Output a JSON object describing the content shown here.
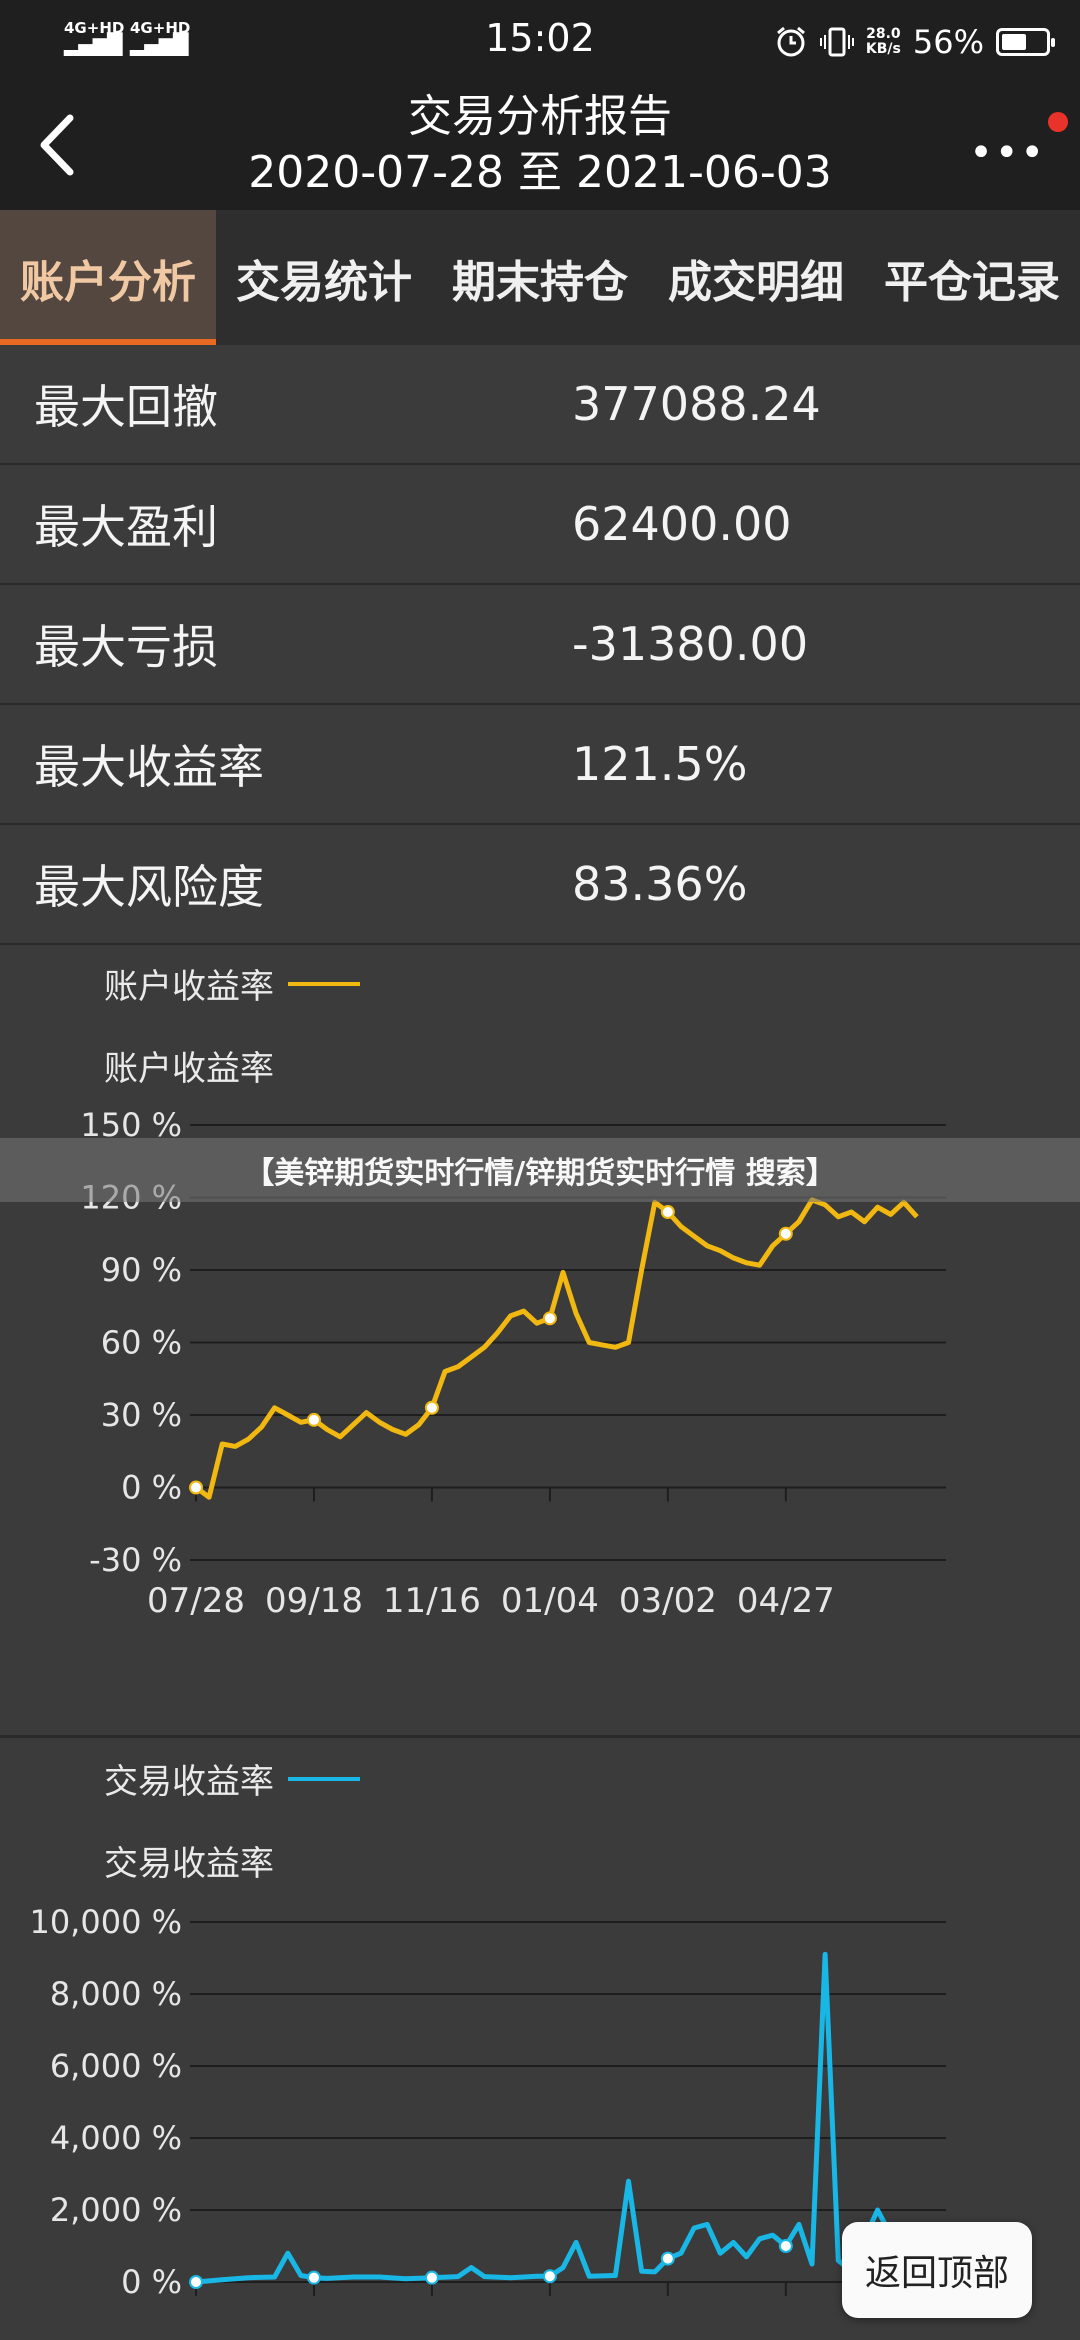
{
  "status": {
    "signal1": "4G+HD",
    "signal2": "4G+HD",
    "time": "15:02",
    "speed_value": "28.0",
    "speed_unit": "KB/s",
    "battery": "56%",
    "battery_level": 0.56,
    "icons": [
      "alarm-icon",
      "vibrate-icon",
      "battery-icon"
    ]
  },
  "header": {
    "title": "交易分析报告",
    "subtitle": "2020-07-28 至 2021-06-03",
    "more": "•••"
  },
  "tabs": [
    {
      "label": "账户分析",
      "active": true
    },
    {
      "label": "交易统计",
      "active": false
    },
    {
      "label": "期末持仓",
      "active": false
    },
    {
      "label": "成交明细",
      "active": false
    },
    {
      "label": "平仓记录",
      "active": false
    }
  ],
  "stats": [
    {
      "label": "最大回撤",
      "value": "377088.24"
    },
    {
      "label": "最大盈利",
      "value": "62400.00"
    },
    {
      "label": "最大亏损",
      "value": "-31380.00"
    },
    {
      "label": "最大收益率",
      "value": "121.5%"
    },
    {
      "label": "最大风险度",
      "value": "83.36%"
    }
  ],
  "banner": "【美锌期货实时行情/锌期货实时行情 搜索】",
  "back_to_top": "返回顶部",
  "colors": {
    "account_line": "#f1b811",
    "trade_line": "#19b7e6",
    "accent": "#e86a22"
  },
  "chart_data": [
    {
      "type": "line",
      "title": "账户收益率",
      "legend": "账户收益率",
      "series": [
        {
          "name": "账户收益率",
          "color": "#f1b811"
        }
      ],
      "ylabels": [
        "150 %",
        "120 %",
        "90 %",
        "60 %",
        "30 %",
        "0 %",
        "-30 %"
      ],
      "ylim": [
        -30,
        150
      ],
      "xlabels": [
        "07/28",
        "09/18",
        "11/16",
        "01/04",
        "03/02",
        "04/27"
      ],
      "xlim": [
        0,
        56
      ],
      "grid": "horizontal",
      "x": [
        0,
        1,
        2,
        3,
        4,
        5,
        6,
        7,
        8,
        9,
        10,
        11,
        12,
        13,
        14,
        15,
        16,
        17,
        18,
        19,
        20,
        21,
        22,
        23,
        24,
        25,
        26,
        27,
        28,
        29,
        30,
        31,
        32,
        33,
        34,
        35,
        36,
        37,
        38,
        39,
        40,
        41,
        42,
        43,
        44,
        45,
        46,
        47,
        48,
        49,
        50,
        51,
        52,
        53,
        54,
        55
      ],
      "values": [
        0,
        -4,
        18,
        17,
        20,
        25,
        33,
        30,
        27,
        28,
        24,
        21,
        26,
        31,
        27,
        24,
        22,
        26,
        33,
        48,
        50,
        54,
        58,
        64,
        71,
        73,
        68,
        70,
        89,
        72,
        60,
        59,
        58,
        60,
        90,
        118,
        114,
        108,
        104,
        100,
        98,
        95,
        93,
        92,
        100,
        105,
        110,
        119,
        117,
        112,
        114,
        110,
        116,
        113,
        118,
        112
      ],
      "markers": [
        0,
        9,
        18,
        27,
        36,
        45
      ]
    },
    {
      "type": "line",
      "title": "交易收益率",
      "legend": "交易收益率",
      "series": [
        {
          "name": "交易收益率",
          "color": "#19b7e6"
        }
      ],
      "ylabels": [
        "10,000 %",
        "8,000 %",
        "6,000 %",
        "4,000 %",
        "2,000 %",
        "0 %"
      ],
      "ylim": [
        0,
        10000
      ],
      "xlim": [
        0,
        56
      ],
      "grid": "horizontal",
      "x": [
        0,
        2,
        4,
        6,
        7,
        8,
        9,
        10,
        12,
        14,
        16,
        18,
        20,
        21,
        22,
        24,
        26,
        27,
        28,
        29,
        30,
        32,
        33,
        34,
        35,
        36,
        37,
        38,
        39,
        40,
        41,
        42,
        43,
        44,
        45,
        46,
        47,
        48,
        49,
        50,
        51,
        52,
        53
      ],
      "values": [
        0,
        60,
        120,
        140,
        800,
        180,
        120,
        100,
        140,
        140,
        90,
        120,
        150,
        400,
        150,
        120,
        160,
        160,
        400,
        1100,
        160,
        180,
        2800,
        300,
        280,
        650,
        800,
        1500,
        1600,
        800,
        1100,
        700,
        1200,
        1300,
        1000,
        1600,
        500,
        9100,
        600,
        300,
        1200,
        2000,
        1300
      ],
      "markers": [
        0,
        9,
        18,
        27,
        36,
        45
      ]
    }
  ]
}
